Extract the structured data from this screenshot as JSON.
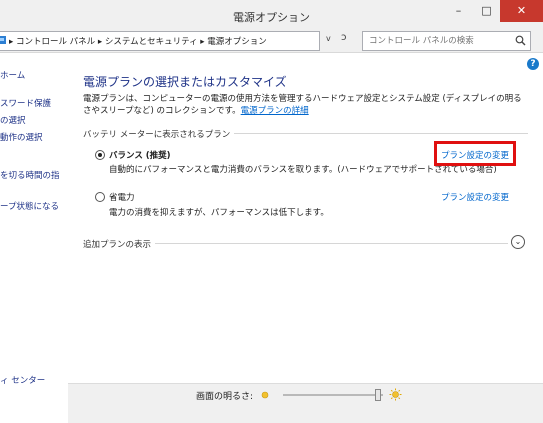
{
  "window": {
    "title": "電源オプション",
    "minimize_label": "–",
    "maximize_label": "□",
    "close_label": "✕"
  },
  "address": {
    "crumbs": "▸ コントロール パネル ▸ システムとセキュリティ ▸ 電源オプション",
    "dropdown_glyph": "v",
    "refresh_glyph": "ↄ",
    "search_placeholder": "コントロール パネルの検索"
  },
  "sidebar": {
    "items": [
      {
        "label": "ホーム"
      },
      {
        "label": "スワード保護"
      },
      {
        "label": "の選択"
      },
      {
        "label": "動作の選択"
      },
      {
        "label": "を切る時間の指"
      },
      {
        "label": "ープ状態になる"
      },
      {
        "label": "ィ センター"
      }
    ]
  },
  "main": {
    "heading": "電源プランの選択またはカスタマイズ",
    "desc_text": "電源プランは、コンピューターの電源の使用方法を管理するハードウェア設定とシステム設定 (ディスプレイの明るさやスリープなど) のコレクションです。",
    "desc_link": "電源プランの詳細",
    "section_label": "バッテリ メーターに表示されるプラン",
    "plans": [
      {
        "name": "バランス (推奨)",
        "desc": "自動的にパフォーマンスと電力消費のバランスを取ります。(ハードウェアでサポートされている場合)",
        "link": "プラン設定の変更",
        "selected": true
      },
      {
        "name": "省電力",
        "desc": "電力の消費を抑えますが、パフォーマンスは低下します。",
        "link": "プラン設定の変更",
        "selected": false
      }
    ],
    "expand_label": "追加プランの表示",
    "expand_glyph": "⌄"
  },
  "bottom": {
    "brightness_label": "画面の明るさ:",
    "brightness_level": 0.95
  },
  "colors": {
    "link": "#0066cc",
    "heading": "#1e3287",
    "highlight": "#e01010",
    "close_button": "#c7382d"
  },
  "icons": {
    "address": "control-panel-icon",
    "search": "search-icon",
    "help": "help-icon",
    "brightness_low": "sun-small-icon",
    "brightness_high": "sun-large-icon"
  }
}
